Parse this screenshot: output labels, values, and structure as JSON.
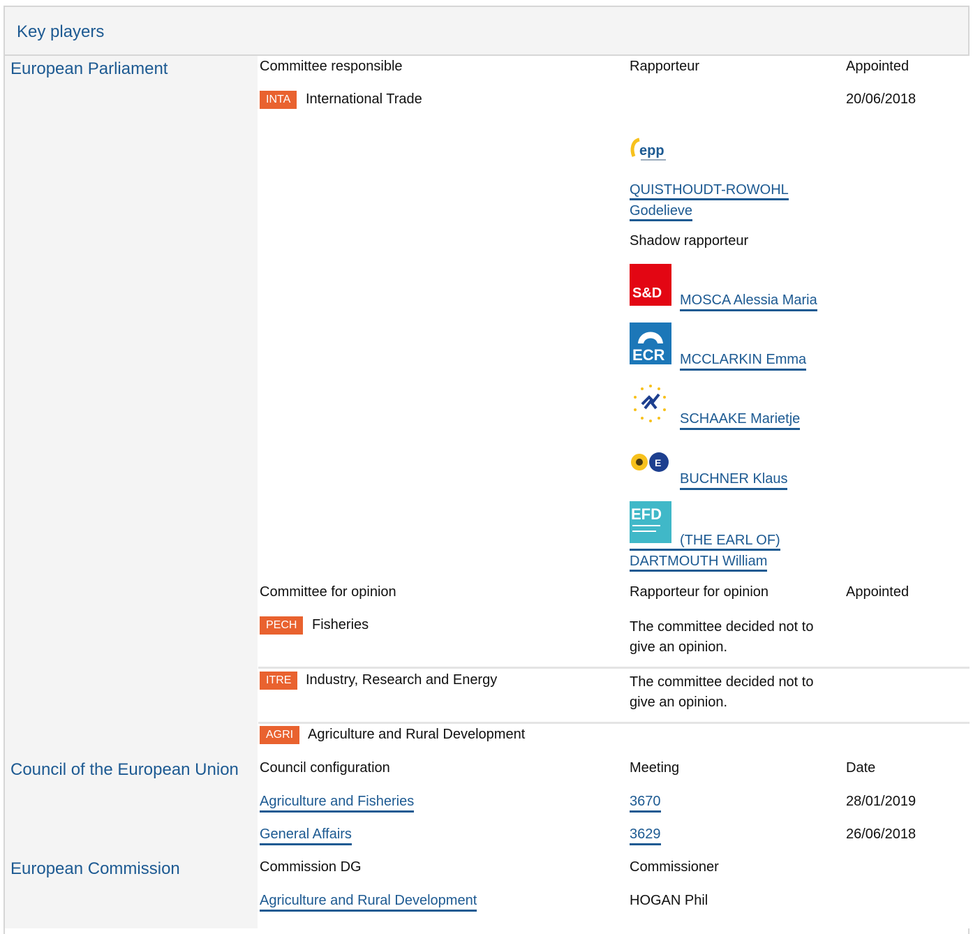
{
  "title": "Key players",
  "ep": {
    "label": "European Parliament",
    "headers": {
      "committee": "Committee responsible",
      "rapporteur": "Rapporteur",
      "appointed": "Appointed"
    },
    "responsible": {
      "code": "INTA",
      "name": "International Trade",
      "date": "20/06/2018"
    },
    "rapporteur": {
      "name_line1": "QUISTHOUDT-ROWOHL",
      "name_line2": "Godelieve",
      "group_logo": "EPP"
    },
    "shadow_label": "Shadow rapporteur",
    "shadows": [
      {
        "name": "MOSCA Alessia Maria",
        "group_logo": "S&D"
      },
      {
        "name": "MCCLARKIN Emma",
        "group_logo": "ECR"
      },
      {
        "name": "SCHAAKE Marietje",
        "group_logo": "ALDE"
      },
      {
        "name": "BUCHNER Klaus",
        "group_logo": "Greens/EFA"
      },
      {
        "name_line1": "(THE EARL OF)",
        "name_line2": "DARTMOUTH William",
        "group_logo": "EFD"
      }
    ],
    "opinion_headers": {
      "committee": "Committee for opinion",
      "rapporteur": "Rapporteur for opinion",
      "appointed": "Appointed"
    },
    "opinions": [
      {
        "code": "PECH",
        "name": "Fisheries",
        "note_l1": "The committee decided not to",
        "note_l2": "give an opinion."
      },
      {
        "code": "ITRE",
        "name": "Industry, Research and Energy",
        "note_l1": "The committee decided not to",
        "note_l2": "give an opinion."
      },
      {
        "code": "AGRI",
        "name": "Agriculture and Rural Development"
      }
    ]
  },
  "council": {
    "label": "Council of the European Union",
    "headers": {
      "config": "Council configuration",
      "meeting": "Meeting",
      "date": "Date"
    },
    "rows": [
      {
        "config": "Agriculture and Fisheries",
        "meeting": "3670",
        "date": "28/01/2019"
      },
      {
        "config": "General Affairs",
        "meeting": "3629",
        "date": "26/06/2018"
      }
    ]
  },
  "commission": {
    "label": "European Commission",
    "headers": {
      "dg": "Commission DG",
      "commissioner": "Commissioner"
    },
    "dg": "Agriculture and Rural Development",
    "commissioner": "HOGAN Phil"
  },
  "colors": {
    "link": "#1d5a92",
    "badge": "#e9622f",
    "panel": "#f4f4f4"
  }
}
